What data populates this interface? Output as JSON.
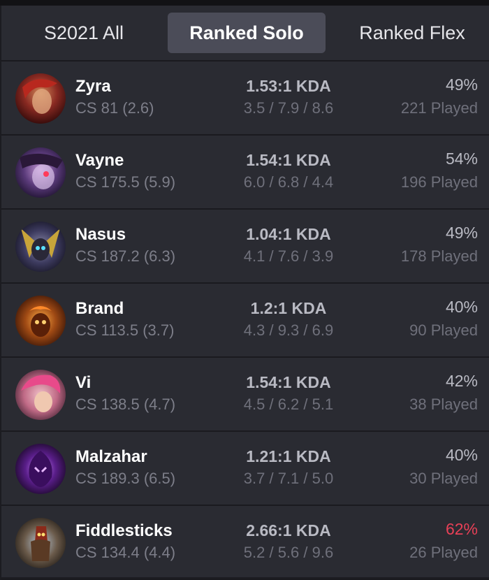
{
  "tabs": [
    {
      "label": "S2021 All",
      "active": false
    },
    {
      "label": "Ranked Solo",
      "active": true
    },
    {
      "label": "Ranked Flex",
      "active": false
    }
  ],
  "champions": [
    {
      "name": "Zyra",
      "cs": "CS 81 (2.6)",
      "kda": "1.53:1 KDA",
      "kda_detail": "3.5 / 7.9 / 8.6",
      "winrate": "49%",
      "played": "221 Played",
      "avatar_color": "#8a2a22"
    },
    {
      "name": "Vayne",
      "cs": "CS 175.5 (5.9)",
      "kda": "1.54:1 KDA",
      "kda_detail": "6.0 / 6.8 / 4.4",
      "winrate": "54%",
      "played": "196 Played",
      "avatar_color": "#5a3a7a"
    },
    {
      "name": "Nasus",
      "cs": "CS 187.2 (6.3)",
      "kda": "1.04:1 KDA",
      "kda_detail": "4.1 / 7.6 / 3.9",
      "winrate": "49%",
      "played": "178 Played",
      "avatar_color": "#3c3a5e"
    },
    {
      "name": "Brand",
      "cs": "CS 113.5 (3.7)",
      "kda": "1.2:1 KDA",
      "kda_detail": "4.3 / 9.3 / 6.9",
      "winrate": "40%",
      "played": "90 Played",
      "avatar_color": "#a04a14"
    },
    {
      "name": "Vi",
      "cs": "CS 138.5 (4.7)",
      "kda": "1.54:1 KDA",
      "kda_detail": "4.5 / 6.2 / 5.1",
      "winrate": "42%",
      "played": "38 Played",
      "avatar_color": "#c06a86"
    },
    {
      "name": "Malzahar",
      "cs": "CS 189.3 (6.5)",
      "kda": "1.21:1 KDA",
      "kda_detail": "3.7 / 7.1 / 5.0",
      "winrate": "40%",
      "played": "30 Played",
      "avatar_color": "#5a1e8a"
    },
    {
      "name": "Fiddlesticks",
      "cs": "CS 134.4 (4.4)",
      "kda": "2.66:1 KDA",
      "kda_detail": "5.2 / 5.6 / 9.6",
      "winrate": "62%",
      "played": "26 Played",
      "avatar_color": "#6a5a4a",
      "winrate_color": "#e84057"
    }
  ]
}
